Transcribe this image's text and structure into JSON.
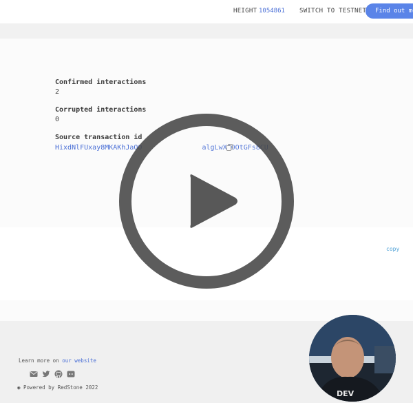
{
  "header": {
    "height_label": "HEIGHT",
    "height_value": "1054861",
    "switch_label": "SWITCH TO TESTNET",
    "cta_label": "Find out mo"
  },
  "contract": {
    "confirmed_label": "Confirmed interactions",
    "confirmed_value": "2",
    "corrupted_label": "Corrupted interactions",
    "corrupted_value": "0",
    "source_label": "Source transaction id",
    "source_value": "HixdNlFUxay8MKAKhJaOO",
    "source_value_tail": "algLwX00OtGFs8CU"
  },
  "panel": {
    "copy_label": "copy"
  },
  "footer": {
    "learn_more_prefix": "Learn more on",
    "website_link": "our website",
    "powered_by": "Powered by RedStone 2022",
    "icons": [
      "mail-icon",
      "twitter-icon",
      "github-icon",
      "discord-icon"
    ]
  },
  "video": {
    "play_icon": "play-icon"
  },
  "colors": {
    "accent": "#5a84e8",
    "link": "#4a6fd6",
    "footer_bg": "#f0f0f0"
  }
}
